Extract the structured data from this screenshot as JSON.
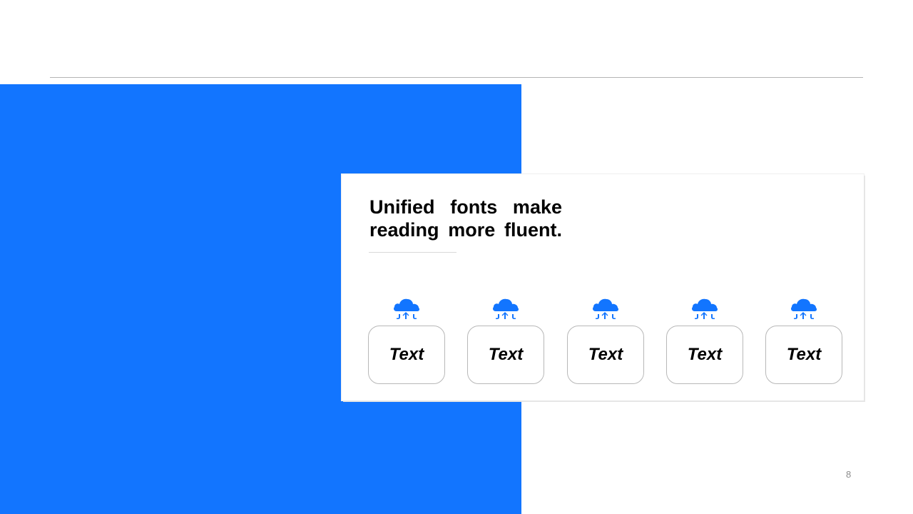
{
  "slide": {
    "headline": "Unified fonts make reading more fluent.",
    "page_number": "8"
  },
  "colors": {
    "accent": "#1275FF",
    "panel_background": "#FFFFFF",
    "rule": "#B5B5B5"
  },
  "items": [
    {
      "icon": "cloud-upload-icon",
      "label": "Text"
    },
    {
      "icon": "cloud-upload-icon",
      "label": "Text"
    },
    {
      "icon": "cloud-upload-icon",
      "label": "Text"
    },
    {
      "icon": "cloud-upload-icon",
      "label": "Text"
    },
    {
      "icon": "cloud-upload-icon",
      "label": "Text"
    }
  ]
}
